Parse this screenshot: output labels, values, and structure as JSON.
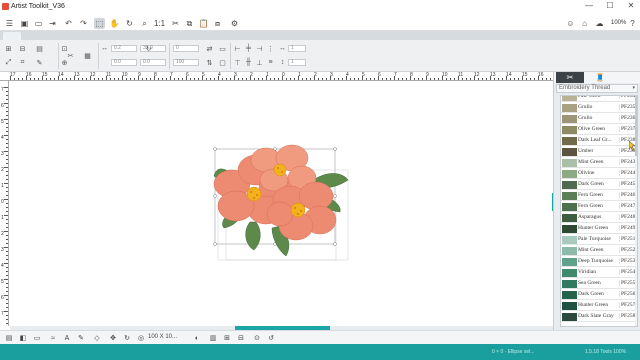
{
  "window": {
    "title": "Artist Toolkit_V36",
    "min": "—",
    "max": "☐",
    "close": "✕"
  },
  "toolbar": {
    "zoom": "100%"
  },
  "options": {
    "field_1": "0.2",
    "field_2": "0.0",
    "field_3": "31.9",
    "field_4": "0.0",
    "field_5": "0",
    "field_6": "100",
    "field_7": "1",
    "field_8": "1"
  },
  "ruler_top": [
    "17",
    "16",
    "15",
    "14",
    "13",
    "12",
    "11",
    "10",
    "9",
    "8",
    "7",
    "6",
    "5",
    "4",
    "3",
    "2",
    "1",
    "0",
    "1",
    "2",
    "3",
    "4",
    "5",
    "6",
    "7",
    "8",
    "9",
    "10",
    "11",
    "12",
    "13",
    "14",
    "15",
    "16",
    "17"
  ],
  "ruler_left": [
    "7",
    "6",
    "5",
    "4",
    "3",
    "2",
    "1",
    "0",
    "1",
    "2",
    "3",
    "4",
    "5",
    "6",
    "7"
  ],
  "panel": {
    "select_label": "Embroidery Thread",
    "threads": [
      {
        "name": "Pale Glow",
        "code": "PF234",
        "color": "#b7b294"
      },
      {
        "name": "Grullo",
        "code": "PF235",
        "color": "#a9a282"
      },
      {
        "name": "Grullo",
        "code": "PF236",
        "color": "#9d9676"
      },
      {
        "name": "Olive Green",
        "code": "PF237",
        "color": "#8e8a62"
      },
      {
        "name": "Dark Leaf Gr...",
        "code": "PF238",
        "color": "#726b4a"
      },
      {
        "name": "Umber",
        "code": "PF239",
        "color": "#5e5540"
      },
      {
        "name": "Mint Green",
        "code": "PF243",
        "color": "#a9bfa6"
      },
      {
        "name": "Olivine",
        "code": "PF244",
        "color": "#8eaa84"
      },
      {
        "name": "Dark Green",
        "code": "PF245",
        "color": "#4f6a4e"
      },
      {
        "name": "Fern Green",
        "code": "PF246",
        "color": "#5b7d58"
      },
      {
        "name": "Fern Green",
        "code": "PF247",
        "color": "#4d714c"
      },
      {
        "name": "Asparagus",
        "code": "PF248",
        "color": "#3f5e3f"
      },
      {
        "name": "Hunter Green",
        "code": "PF249",
        "color": "#2e4a33"
      },
      {
        "name": "Pale Turquoise",
        "code": "PF251",
        "color": "#a8c9bd"
      },
      {
        "name": "Mint Green",
        "code": "PF252",
        "color": "#8cbca9"
      },
      {
        "name": "Deep Turquoise",
        "code": "PF253",
        "color": "#5fa18a"
      },
      {
        "name": "Viridian",
        "code": "PF254",
        "color": "#3f8a6f"
      },
      {
        "name": "Sea Green",
        "code": "PF255",
        "color": "#2f7a60"
      },
      {
        "name": "Dark Green",
        "code": "PF256",
        "color": "#25644c"
      },
      {
        "name": "Hunter Green",
        "code": "PF257",
        "color": "#1f5240"
      },
      {
        "name": "Dark Slate Gray",
        "code": "PF258",
        "color": "#2a4a40"
      }
    ]
  },
  "statusbar": {
    "size_label": "100 X 10..."
  },
  "bottombar": {
    "status": "0 × 0 · Ellipse sel...",
    "right": "1.5.18  Tools 100%"
  },
  "colors": {
    "accent": "#1aa6a6",
    "petal": "#ec8a72",
    "leaf": "#5d8a4a",
    "center": "#f3b21c"
  }
}
